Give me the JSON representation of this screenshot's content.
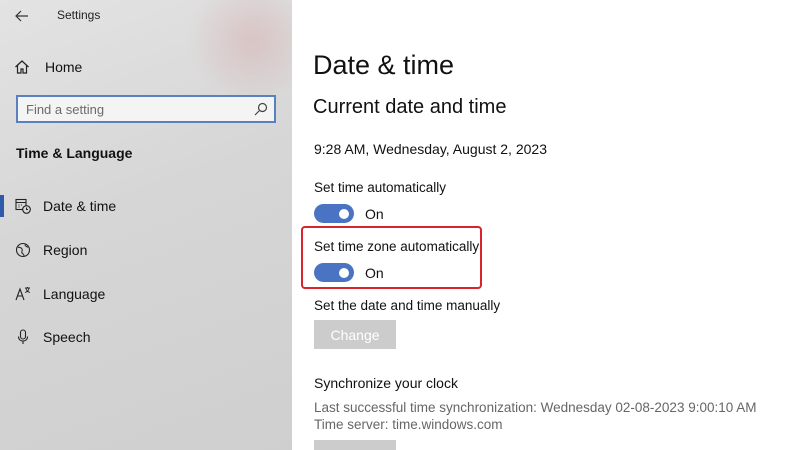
{
  "window": {
    "title": "Settings"
  },
  "sidebar": {
    "home_label": "Home",
    "search_placeholder": "Find a setting",
    "section_title": "Time & Language",
    "items": [
      {
        "label": "Date & time",
        "icon": "calendar-clock-icon",
        "active": true
      },
      {
        "label": "Region",
        "icon": "globe-icon",
        "active": false
      },
      {
        "label": "Language",
        "icon": "language-icon",
        "active": false
      },
      {
        "label": "Speech",
        "icon": "microphone-icon",
        "active": false
      }
    ]
  },
  "main": {
    "title": "Date & time",
    "subtitle": "Current date and time",
    "current_datetime": "9:28 AM, Wednesday, August 2, 2023",
    "set_time_auto": {
      "label": "Set time automatically",
      "state": "On"
    },
    "set_timezone_auto": {
      "label": "Set time zone automatically",
      "state": "On"
    },
    "manual": {
      "label": "Set the date and time manually",
      "button": "Change"
    },
    "sync": {
      "heading": "Synchronize your clock",
      "last_sync": "Last successful time synchronization: Wednesday 02-08-2023 9:00:10 AM",
      "time_server": "Time server: time.windows.com"
    }
  },
  "colors": {
    "accent": "#4a73c4",
    "highlight": "#d9232e",
    "button_disabled": "#cccccc"
  }
}
